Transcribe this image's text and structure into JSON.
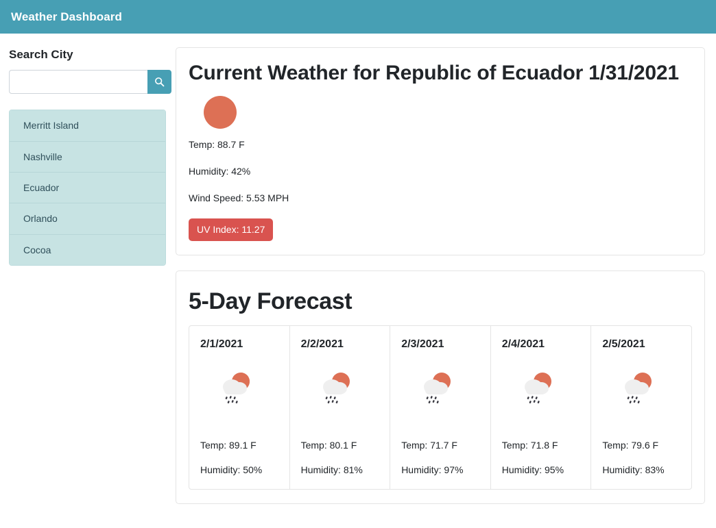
{
  "header": {
    "title": "Weather Dashboard",
    "background_color": "#479fb4"
  },
  "sidebar": {
    "search_label": "Search City",
    "search_input_value": "",
    "search_input_placeholder": "",
    "search_button_icon": "search-icon",
    "cities": [
      {
        "name": "Merritt Island"
      },
      {
        "name": "Nashville"
      },
      {
        "name": "Ecuador"
      },
      {
        "name": "Orlando"
      },
      {
        "name": "Cocoa"
      }
    ],
    "city_item_color": "#c7e3e3"
  },
  "current_weather": {
    "title": "Current Weather for Republic of Ecuador 1/31/2021",
    "icon": "sun-icon",
    "icon_color": "#dd7055",
    "temp": "Temp: 88.7 F",
    "humidity": "Humidity: 42%",
    "wind_speed": "Wind Speed: 5.53 MPH",
    "uv_index": "UV Index: 11.27",
    "uv_badge_color": "#d9534f"
  },
  "forecast": {
    "title": "5-Day Forecast",
    "days": [
      {
        "date": "2/1/2021",
        "icon": "cloud-sun-rain-icon",
        "temp": "Temp: 89.1 F",
        "humidity": "Humidity: 50%"
      },
      {
        "date": "2/2/2021",
        "icon": "cloud-sun-rain-icon",
        "temp": "Temp: 80.1 F",
        "humidity": "Humidity: 81%"
      },
      {
        "date": "2/3/2021",
        "icon": "cloud-sun-rain-icon",
        "temp": "Temp: 71.7 F",
        "humidity": "Humidity: 97%"
      },
      {
        "date": "2/4/2021",
        "icon": "cloud-sun-rain-icon",
        "temp": "Temp: 71.8 F",
        "humidity": "Humidity: 95%"
      },
      {
        "date": "2/5/2021",
        "icon": "cloud-sun-rain-icon",
        "temp": "Temp: 79.6 F",
        "humidity": "Humidity: 83%"
      }
    ]
  }
}
